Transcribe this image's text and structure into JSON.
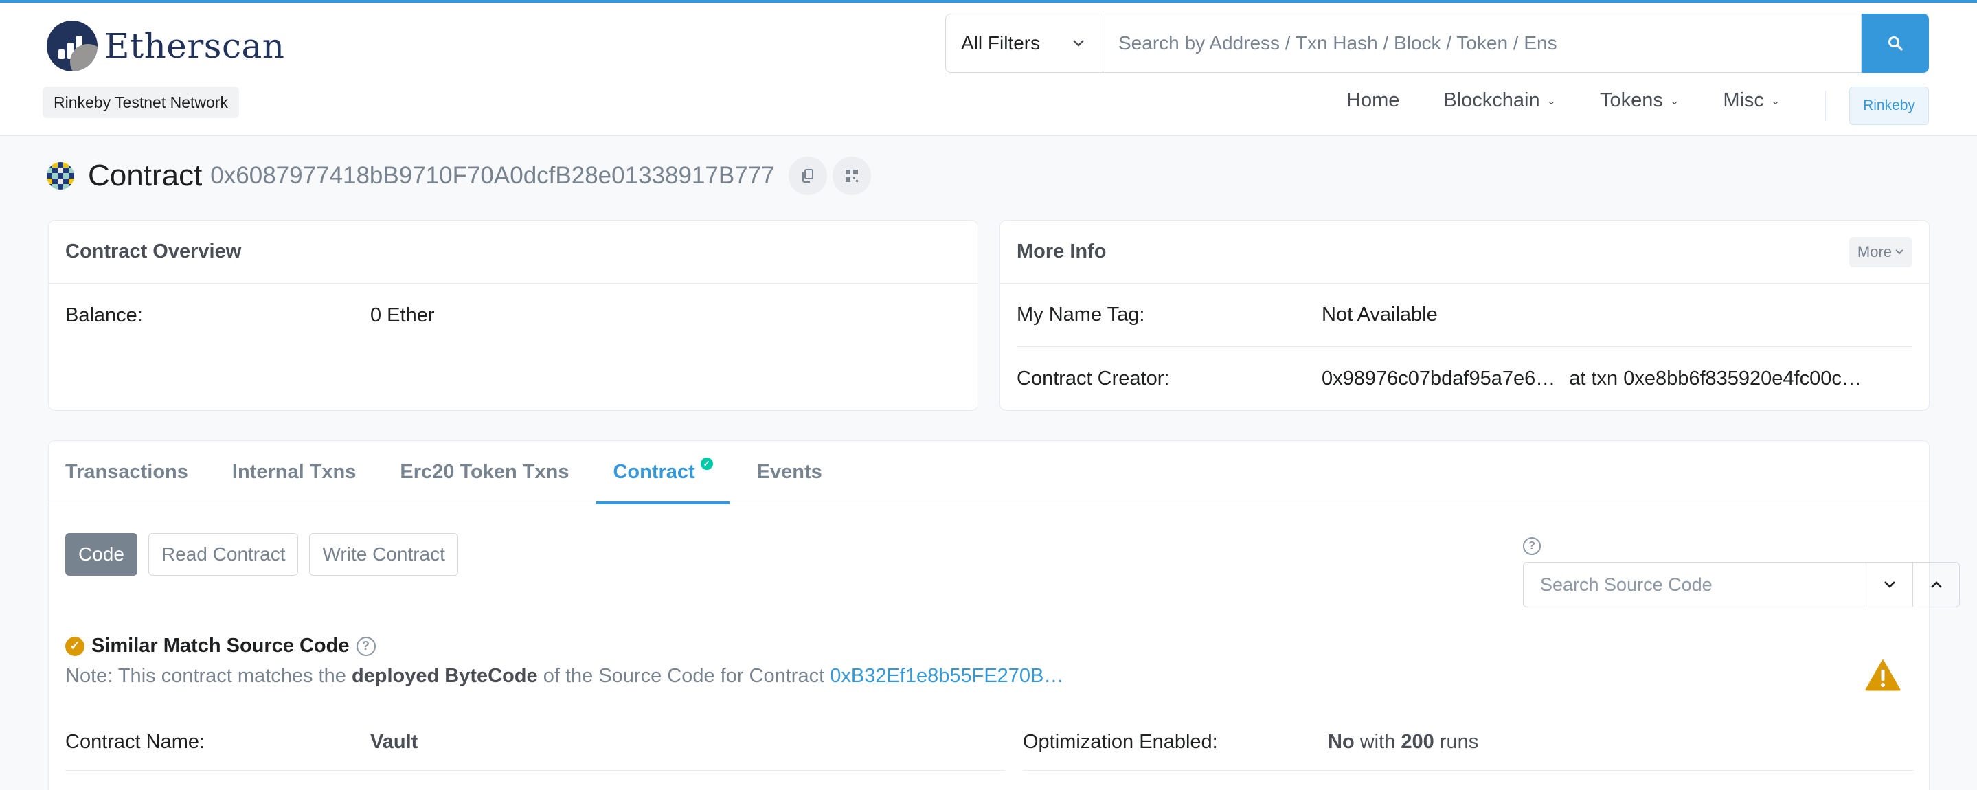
{
  "brand": {
    "name": "Etherscan",
    "network_badge": "Rinkeby Testnet Network"
  },
  "search": {
    "filter_label": "All Filters",
    "placeholder": "Search by Address / Txn Hash / Block / Token / Ens"
  },
  "nav": {
    "home": "Home",
    "blockchain": "Blockchain",
    "tokens": "Tokens",
    "misc": "Misc",
    "network": "Rinkeby"
  },
  "page": {
    "title": "Contract",
    "address": "0x6087977418bB9710F70A0dcfB28e01338917B777"
  },
  "overview": {
    "header": "Contract Overview",
    "balance_label": "Balance:",
    "balance_value": "0 Ether"
  },
  "more_info": {
    "header": "More Info",
    "more_button": "More",
    "name_tag_label": "My Name Tag:",
    "name_tag_value": "Not Available",
    "creator_label": "Contract Creator:",
    "creator_address": "0x98976c07bdaf95a7e6…",
    "at_txn": "at txn",
    "creator_txn": "0xe8bb6f835920e4fc00c…"
  },
  "tabs": [
    "Transactions",
    "Internal Txns",
    "Erc20 Token Txns",
    "Contract",
    "Events"
  ],
  "contract_buttons": [
    "Code",
    "Read Contract",
    "Write Contract"
  ],
  "source_search": {
    "placeholder": "Search Source Code"
  },
  "match": {
    "title": "Similar Match Source Code",
    "note_prefix": "Note: This contract matches the ",
    "note_bold": "deployed ByteCode",
    "note_mid": " of the Source Code for Contract ",
    "note_link": "0xB32Ef1e8b55FE270B…"
  },
  "details": {
    "name_label": "Contract Name:",
    "name_value": "Vault",
    "opt_label": "Optimization Enabled:",
    "opt_no": "No",
    "opt_with": " with ",
    "opt_runs_num": "200",
    "opt_runs": " runs"
  },
  "colors": {
    "accent": "#3498db",
    "brand": "#21325b",
    "success": "#00c9a7",
    "warning": "#db9a04"
  }
}
